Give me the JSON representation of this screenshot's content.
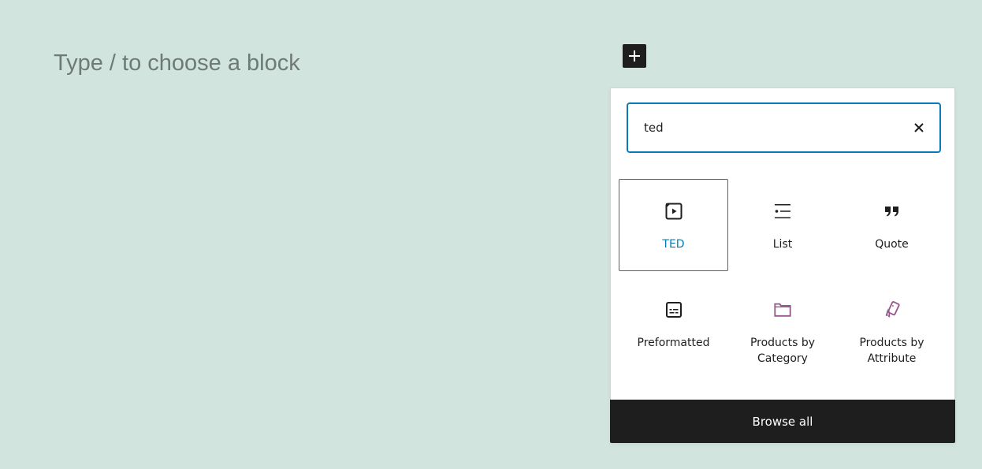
{
  "editor": {
    "placeholder": "Type / to choose a block"
  },
  "inserter": {
    "toggle_icon": "plus-icon",
    "search": {
      "value": "ted",
      "clear_icon": "close-icon"
    },
    "results": [
      {
        "label": "TED",
        "icon": "embed-video-icon",
        "selected": true,
        "icon_color": "#1e1e1e"
      },
      {
        "label": "List",
        "icon": "list-icon",
        "selected": false,
        "icon_color": "#1e1e1e"
      },
      {
        "label": "Quote",
        "icon": "quote-icon",
        "selected": false,
        "icon_color": "#1e1e1e"
      },
      {
        "label": "Preformatted",
        "icon": "preformatted-icon",
        "selected": false,
        "icon_color": "#1e1e1e"
      },
      {
        "label": "Products by Category",
        "icon": "folder-icon",
        "selected": false,
        "icon_color": "#96588a"
      },
      {
        "label": "Products by Attribute",
        "icon": "tag-cards-icon",
        "selected": false,
        "icon_color": "#96588a"
      }
    ],
    "browse_all_label": "Browse all"
  },
  "colors": {
    "background": "#d2e4de",
    "accent": "#0a7bb5",
    "dark": "#1e1e1e",
    "woo_purple": "#96588a"
  }
}
